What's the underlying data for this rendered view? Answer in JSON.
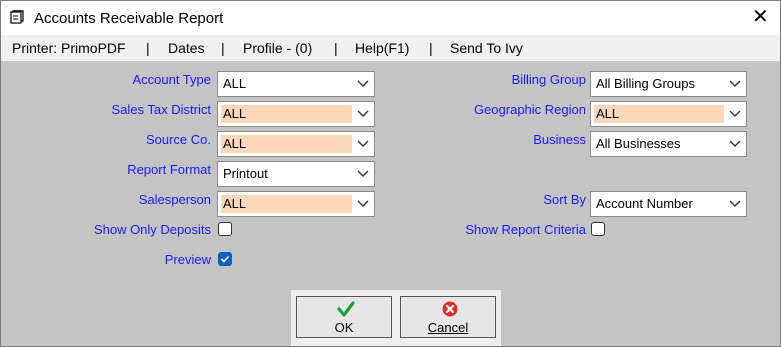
{
  "window": {
    "title": "Accounts Receivable Report",
    "close_glyph": "✕",
    "app_icon": "report-icon"
  },
  "menu": [
    "Printer: PrimoPDF",
    "Dates",
    "Profile - (0)",
    "Help(F1)",
    "Send To Ivy"
  ],
  "menu_separator": "|",
  "fields": {
    "account_type": {
      "label": "Account Type",
      "value": "ALL"
    },
    "sales_tax_district": {
      "label": "Sales Tax District",
      "value": "ALL"
    },
    "source_co": {
      "label": "Source Co.",
      "value": "ALL"
    },
    "report_format": {
      "label": "Report Format",
      "value": "Printout"
    },
    "salesperson": {
      "label": "Salesperson",
      "value": "ALL"
    },
    "billing_group": {
      "label": "Billing Group",
      "value": "All Billing Groups"
    },
    "geographic_region": {
      "label": "Geographic Region",
      "value": "ALL"
    },
    "business": {
      "label": "Business",
      "value": "All Businesses"
    },
    "sort_by": {
      "label": "Sort By",
      "value": "Account Number"
    }
  },
  "checkboxes": {
    "show_only_deposits": {
      "label": "Show Only Deposits",
      "checked": false
    },
    "show_report_criteria": {
      "label": "Show Report Criteria",
      "checked": false
    },
    "preview": {
      "label": "Preview",
      "checked": true
    }
  },
  "buttons": {
    "ok": {
      "label": "OK",
      "icon": "checkmark-icon"
    },
    "cancel": {
      "label": "Cancel",
      "icon": "cancel-icon"
    }
  },
  "colors": {
    "label_blue": "#1a1aff",
    "highlight": "#fcd7b9",
    "checkbox_checked": "#0f5fbd"
  }
}
